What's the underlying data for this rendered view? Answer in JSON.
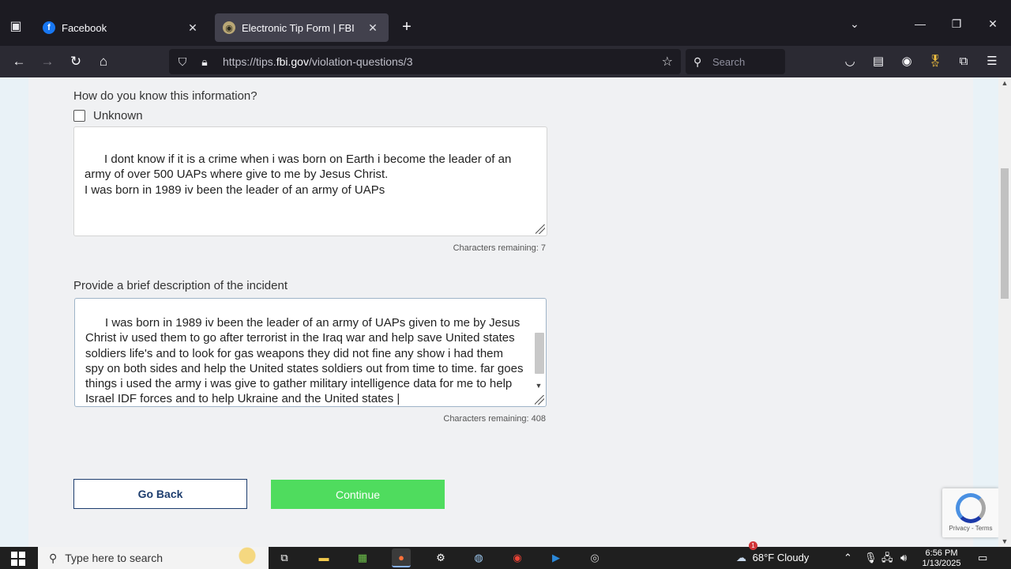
{
  "browser": {
    "tabs": [
      {
        "title": "Facebook",
        "active": false
      },
      {
        "title": "Electronic Tip Form | FBI",
        "active": true
      }
    ],
    "url_prefix": "https://tips.",
    "url_host": "fbi.gov",
    "url_path": "/violation-questions/3",
    "search_placeholder": "Search"
  },
  "form": {
    "q1_label": "How do you know this information?",
    "unknown_label": "Unknown",
    "unknown_checked": false,
    "q1_text": "I dont know if it is a crime when i was born on Earth i become the leader of an army of over 500 UAPs where give to me by Jesus Christ.\nI was born in 1989 iv been the leader of an army of UAPs",
    "q1_counter": "Characters remaining: 7",
    "q2_label": "Provide a brief description of the incident",
    "q2_text": "I was born in 1989 iv been the leader of an army of UAPs given to me by Jesus Christ iv used them to go after terrorist in the Iraq war and help save United states soldiers life's and to look for gas weapons they did not fine any show i had them spy on both sides and help the United states soldiers out from time to time. far goes things i used the army i was give to gather military intelligence data for me to help Israel IDF forces and to help Ukraine and the United states |",
    "q2_counter": "Characters remaining: 408",
    "back_label": "Go Back",
    "continue_label": "Continue"
  },
  "recaptcha": {
    "links": "Privacy - Terms"
  },
  "taskbar": {
    "search_placeholder": "Type here to search",
    "weather": "68°F  Cloudy",
    "weather_badge": "1",
    "time": "6:56 PM",
    "date": "1/13/2025"
  },
  "colors": {
    "continue_bg": "#4fdc5e",
    "back_border": "#1d3d6e",
    "tab_active_bg": "#42414d"
  }
}
